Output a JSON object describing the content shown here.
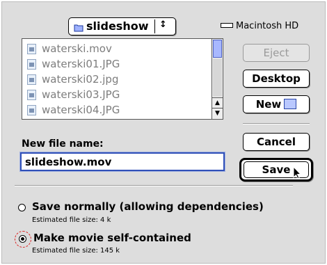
{
  "dialog": {
    "folder_popup": {
      "label": "slideshow",
      "arrows": "↕"
    },
    "disk_label": "Macintosh HD",
    "files": [
      {
        "name": "waterski.mov"
      },
      {
        "name": "waterski01.JPG"
      },
      {
        "name": "waterski02.jpg"
      },
      {
        "name": "waterski03.JPG"
      },
      {
        "name": "waterski04.JPG"
      }
    ],
    "scroll": {
      "up": "▲",
      "down": "▼"
    },
    "buttons": {
      "eject": "Eject",
      "desktop": "Desktop",
      "new": "New",
      "cancel": "Cancel",
      "save": "Save"
    },
    "new_file_label": "New file name:",
    "filename_value": "slideshow.mov",
    "options": [
      {
        "label": "Save normally (allowing dependencies)",
        "estimate": "Estimated file size: 4 k",
        "selected": false
      },
      {
        "label": "Make movie self-contained",
        "estimate": "Estimated file size: 145 k",
        "selected": true
      }
    ]
  }
}
